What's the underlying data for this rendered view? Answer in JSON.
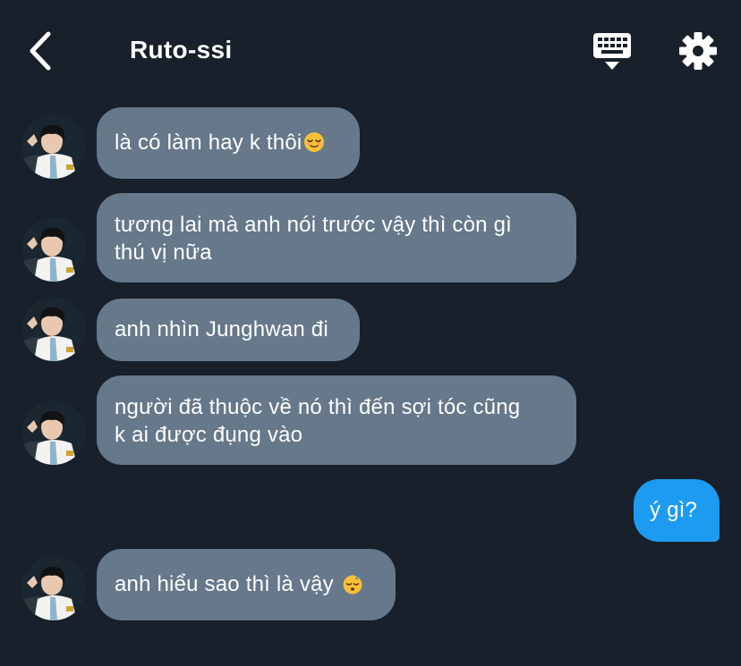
{
  "header": {
    "title": "Ruto-ssi",
    "back_icon": "chevron-left-icon",
    "keyboard_icon": "keyboard-icon",
    "settings_icon": "gear-icon"
  },
  "messages": [
    {
      "sender": "other",
      "text": "là có làm hay k thôi",
      "emoji": "relieved-face"
    },
    {
      "sender": "other",
      "line1": "tương lai mà anh nói trước vậy thì còn gì",
      "line2": "thú vị nữa"
    },
    {
      "sender": "other",
      "text": "anh nhìn Junghwan đi"
    },
    {
      "sender": "other",
      "line1": "người đã thuộc về nó thì đến sợi tóc cũng",
      "line2": "k ai được đụng vào"
    },
    {
      "sender": "me",
      "text": "ý gì?"
    },
    {
      "sender": "other",
      "text": "anh hiểu sao thì là vậy",
      "emoji": "sleeping-face"
    }
  ],
  "colors": {
    "background": "#17202b",
    "incoming_bubble": "#66788a",
    "outgoing_bubble": "#1d9bf0"
  }
}
